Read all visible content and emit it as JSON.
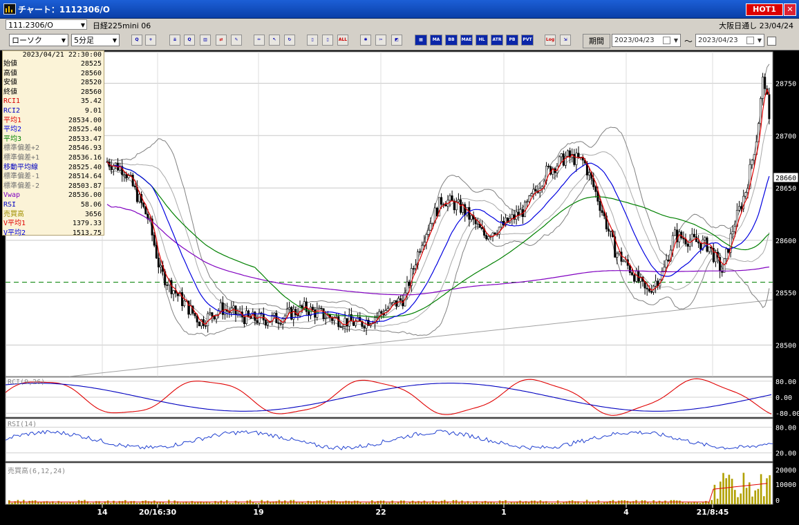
{
  "window": {
    "title": "チャート：1112306/O",
    "hot_label": "HOT1",
    "close_glyph": "✕"
  },
  "info_bar": {
    "symbol_code": "111.2306/O",
    "instrument_name": "日経225mini 06",
    "session_status": "大阪日通し 23/04/24"
  },
  "toolbar": {
    "chart_type": "ローソク",
    "interval": "5分足",
    "indicator_buttons": [
      "MA",
      "BB",
      "MAE",
      "HL",
      "ATR",
      "PB",
      "PVT"
    ],
    "log_label": "Log",
    "all_label": "ALL",
    "period_label": "期間",
    "date_from": "2023/04/23",
    "date_to": "2023/04/23",
    "range_sep": "～"
  },
  "info_panel": {
    "datetime": "2023/04/21  22:30:00",
    "rows": [
      {
        "label": "始値",
        "value": "28525",
        "color": "#000000"
      },
      {
        "label": "高値",
        "value": "28560",
        "color": "#000000"
      },
      {
        "label": "安値",
        "value": "28520",
        "color": "#000000"
      },
      {
        "label": "終値",
        "value": "28560",
        "color": "#000000"
      },
      {
        "label": "RCI1",
        "value": "35.42",
        "color": "#d40000"
      },
      {
        "label": "RCI2",
        "value": "9.01",
        "color": "#0000c0"
      },
      {
        "label": "平均1",
        "value": "28534.00",
        "color": "#e00000"
      },
      {
        "label": "平均2",
        "value": "28525.40",
        "color": "#0000e0"
      },
      {
        "label": "平均3",
        "value": "28533.47",
        "color": "#008000"
      },
      {
        "label": "標準偏差+2",
        "value": "28546.93",
        "color": "#707070"
      },
      {
        "label": "標準偏差+1",
        "value": "28536.16",
        "color": "#707070"
      },
      {
        "label": "移動平均線",
        "value": "28525.40",
        "color": "#0000c0"
      },
      {
        "label": "標準偏差-1",
        "value": "28514.64",
        "color": "#707070"
      },
      {
        "label": "標準偏差-2",
        "value": "28503.87",
        "color": "#707070"
      },
      {
        "label": "Vwap",
        "value": "28536.00",
        "color": "#8000c0"
      },
      {
        "label": "RSI",
        "value": "58.06",
        "color": "#0000c0"
      },
      {
        "label": "売買高",
        "value": "3656",
        "color": "#a09000"
      },
      {
        "label": "V平均1",
        "value": "1379.33",
        "color": "#e00000"
      },
      {
        "label": "V平均2",
        "value": "1513.75",
        "color": "#0000e0"
      }
    ]
  },
  "panels": {
    "rci_label": "RCI(9,26)",
    "rsi_label": "RSI(14)",
    "volume_label": "売買高(6,12,24)"
  },
  "axes": {
    "price_ticks": [
      "28750",
      "28700",
      "28650",
      "28600",
      "28550",
      "28500"
    ],
    "current_price": "28660",
    "rci_ticks": [
      "80.00",
      "0.00",
      "-80.00"
    ],
    "rsi_ticks": [
      "80.00",
      "20.00"
    ],
    "volume_ticks": [
      "20000",
      "10000",
      "0"
    ],
    "time_labels": [
      "14",
      "20/16:30",
      "19",
      "22",
      "1",
      "4",
      "21/8:45"
    ]
  },
  "colors": {
    "bull": "#ffffff",
    "bear": "#000000",
    "ma1": "#e00000",
    "ma2": "#0000e0",
    "ma3": "#008000",
    "vwap": "#8000c0",
    "bands": "#606060",
    "volume": "#b0a000"
  },
  "chart_data": {
    "type": "candlestick",
    "price_axis_range": [
      28470,
      28780
    ],
    "dashed_reference_price": 28560,
    "last_close": 28660,
    "volume_axis_range": [
      0,
      20000
    ]
  }
}
